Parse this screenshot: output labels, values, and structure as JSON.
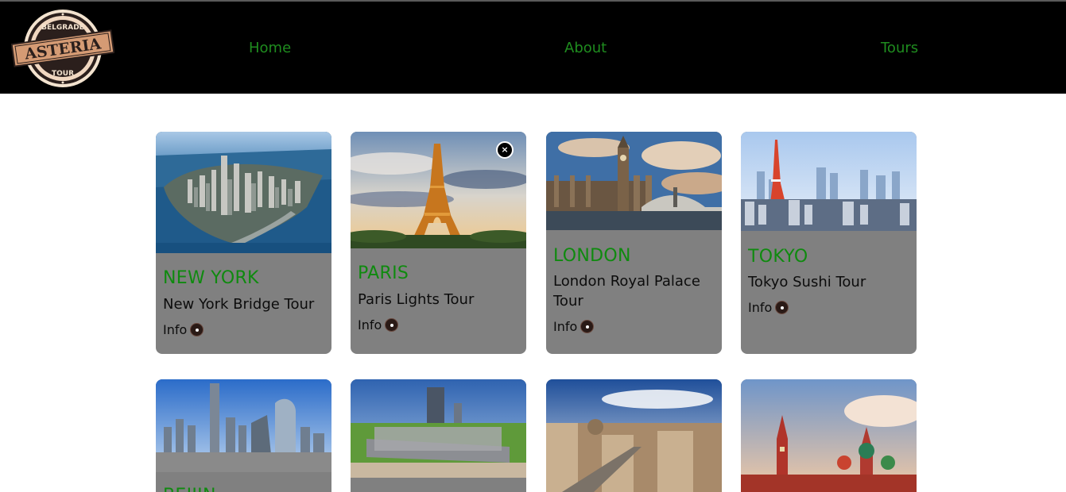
{
  "header": {
    "logo": {
      "top_text": "BELGRADE",
      "main_text": "ASTERIA",
      "bottom_text": "TOUR"
    },
    "nav": [
      {
        "label": "Home"
      },
      {
        "label": "About"
      },
      {
        "label": "Tours"
      }
    ]
  },
  "tours": [
    {
      "city": "NEW YORK",
      "name": "New York Bridge Tour",
      "info_label": "Info"
    },
    {
      "city": "PARIS",
      "name": "Paris Lights Tour",
      "info_label": "Info",
      "close_icon": "×"
    },
    {
      "city": "LONDON",
      "name": "London Royal Palace Tour",
      "info_label": "Info"
    },
    {
      "city": "TOKYO",
      "name": "Tokyo Sushi Tour",
      "info_label": "Info"
    },
    {
      "city": "BEIJIN"
    },
    {
      "city": ""
    },
    {
      "city": ""
    },
    {
      "city": ""
    }
  ],
  "colors": {
    "nav_link": "#1f8c1f",
    "city_title": "#0f8a0f",
    "card_bg": "#808080",
    "header_bg": "#000000"
  }
}
